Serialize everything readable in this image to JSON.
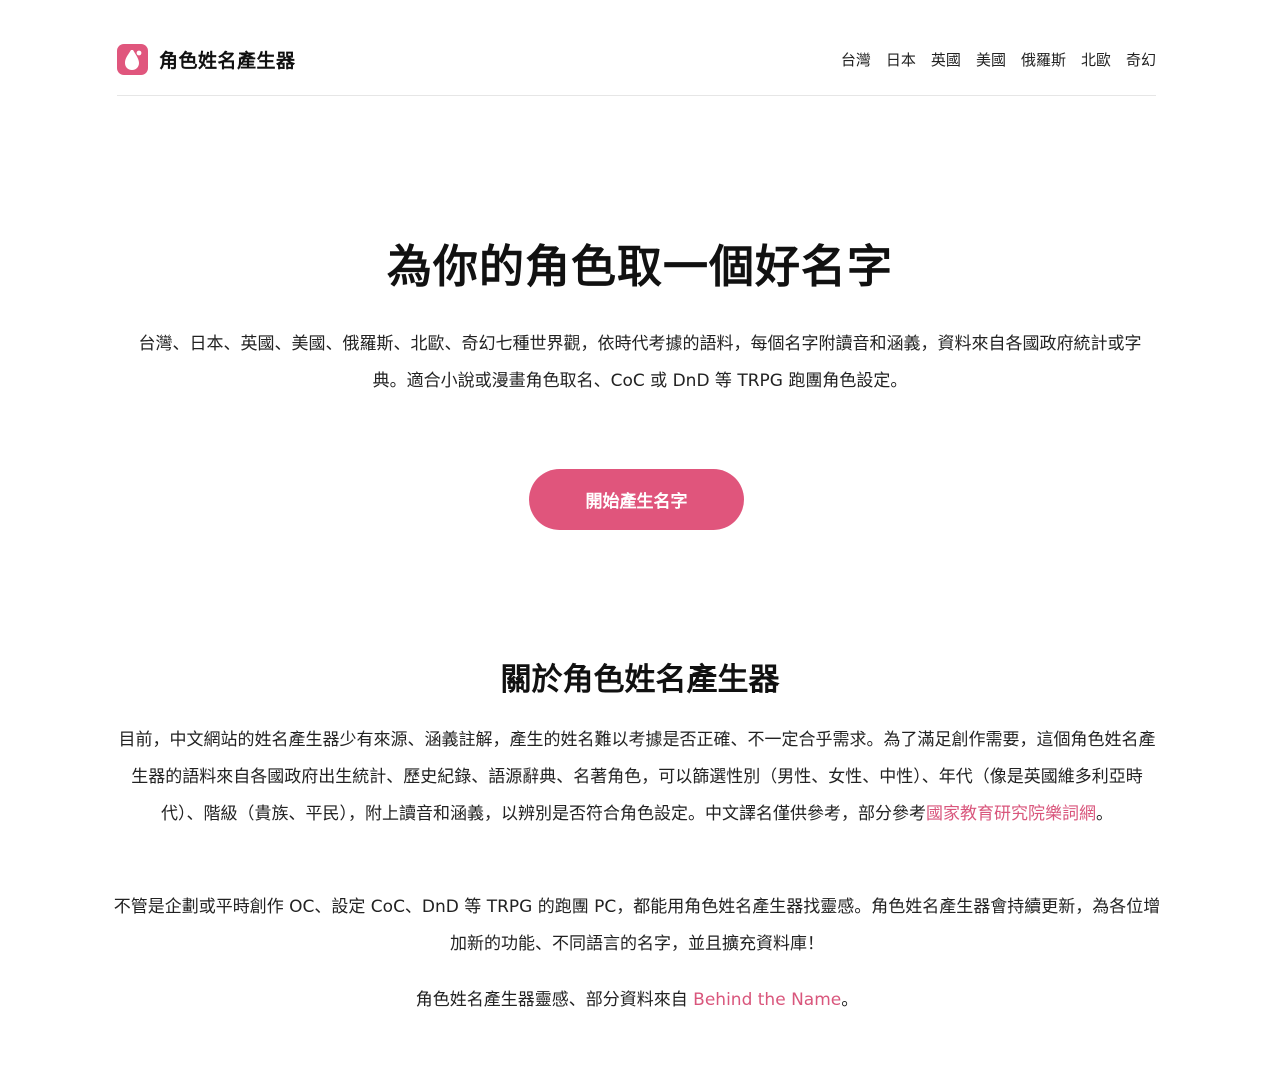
{
  "header": {
    "brand_name": "角色姓名產生器",
    "nav": [
      "台灣",
      "日本",
      "英國",
      "美國",
      "俄羅斯",
      "北歐",
      "奇幻"
    ]
  },
  "hero": {
    "title": "為你的角色取一個好名字",
    "description": "台灣、日本、英國、美國、俄羅斯、北歐、奇幻七種世界觀，依時代考據的語料，每個名字附讀音和涵義，資料來自各國政府統計或字典。適合小說或漫畫角色取名、CoC 或 DnD 等 TRPG 跑團角色設定。",
    "cta_label": "開始產生名字"
  },
  "about": {
    "title": "關於角色姓名產生器",
    "p1_text": "目前，中文網站的姓名產生器少有來源、涵義註解，產生的姓名難以考據是否正確、不一定合乎需求。為了滿足創作需要，這個角色姓名產生器的語料來自各國政府出生統計、歷史紀錄、語源辭典、名著角色，可以篩選性別（男性、女性、中性）、年代（像是英國維多利亞時代）、階級（貴族、平民），附上讀音和涵義，以辨別是否符合角色設定。中文譯名僅供參考，部分參考",
    "p1_link": "國家教育研究院樂詞網",
    "p1_end": "。",
    "p2_text": "不管是企劃或平時創作 OC、設定 CoC、DnD 等 TRPG 的跑團 PC，都能用角色姓名產生器找靈感。角色姓名產生器會持續更新，為各位增加新的功能、不同語言的名字，並且擴充資料庫！",
    "p3_text": "角色姓名產生器靈感、部分資料來自 ",
    "p3_link": "Behind the Name",
    "p3_end": "。"
  },
  "colors": {
    "accent": "#e0557c",
    "link": "#d9567c"
  },
  "icons": {
    "logo": "drop-logo-icon"
  }
}
